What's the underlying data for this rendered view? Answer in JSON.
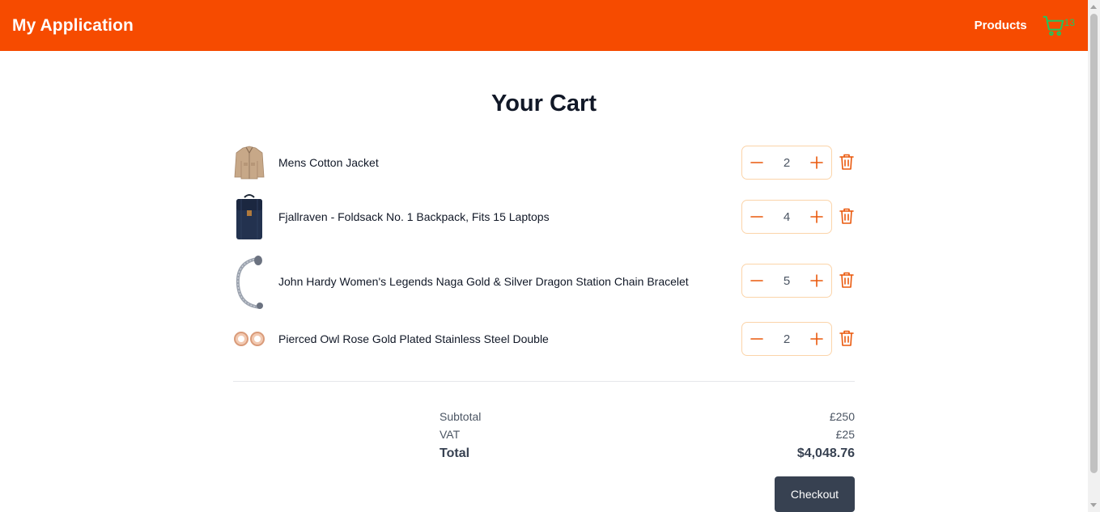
{
  "header": {
    "brand": "My Application",
    "nav_products": "Products",
    "cart_count": "13",
    "cart_icon": "cart-icon"
  },
  "page": {
    "title": "Your Cart"
  },
  "items": [
    {
      "name": "Mens Cotton Jacket",
      "quantity": "2",
      "image": "jacket"
    },
    {
      "name": "Fjallraven - Foldsack No. 1 Backpack, Fits 15 Laptops",
      "quantity": "4",
      "image": "backpack"
    },
    {
      "name": "John Hardy Women's Legends Naga Gold & Silver Dragon Station Chain Bracelet",
      "quantity": "5",
      "image": "bracelet"
    },
    {
      "name": "Pierced Owl Rose Gold Plated Stainless Steel Double",
      "quantity": "2",
      "image": "earrings"
    }
  ],
  "summary": {
    "subtotal_label": "Subtotal",
    "subtotal_value": "£250",
    "vat_label": "VAT",
    "vat_value": "£25",
    "total_label": "Total",
    "total_value": "$4,048.76"
  },
  "checkout_label": "Checkout",
  "colors": {
    "nav": "#f64b00",
    "accent": "#ea580c",
    "cart_badge": "#22c55e",
    "checkout_bg": "#374151"
  }
}
